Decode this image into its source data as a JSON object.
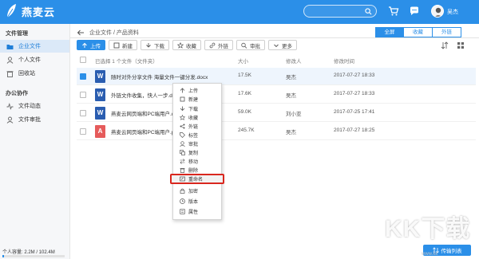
{
  "app": {
    "title": "燕麦云",
    "username": "吴杰",
    "brand_color": "#2b8fe8"
  },
  "search": {
    "placeholder": ""
  },
  "top_icons": [
    "cart-icon",
    "chat-icon",
    "message-icon"
  ],
  "sidebar": {
    "groups": [
      {
        "label": "文件管理",
        "items": [
          {
            "label": "企业文件",
            "icon": "folder-icon",
            "active": true
          },
          {
            "label": "个人文件",
            "icon": "person-icon",
            "active": false
          },
          {
            "label": "回收站",
            "icon": "trash-icon",
            "active": false
          }
        ]
      },
      {
        "label": "办公协作",
        "items": [
          {
            "label": "文件动态",
            "icon": "activity-icon",
            "active": false
          },
          {
            "label": "文件审批",
            "icon": "approve-icon",
            "active": false
          }
        ]
      }
    ],
    "storage_text": "个人容量: 2.2M / 102.4M",
    "storage_fraction": 0.02
  },
  "breadcrumb": {
    "text": "企业文件 / 产品资料"
  },
  "view_tabs": [
    {
      "label": "全屏",
      "active": true
    },
    {
      "label": "收藏",
      "active": false
    },
    {
      "label": "外链",
      "active": false
    }
  ],
  "toolbar": [
    {
      "label": "上传",
      "icon": "upload-icon",
      "primary": true
    },
    {
      "label": "新建",
      "icon": "new-icon",
      "primary": false
    },
    {
      "label": "下载",
      "icon": "download-icon",
      "primary": false
    },
    {
      "label": "收藏",
      "icon": "star-icon",
      "primary": false
    },
    {
      "label": "外链",
      "icon": "link-icon",
      "primary": false
    },
    {
      "label": "审批",
      "icon": "approve-icon",
      "primary": false
    },
    {
      "label": "更多",
      "icon": "more-icon",
      "primary": false
    }
  ],
  "table": {
    "headers": {
      "name": "已选择 1 个文件（文件夹）",
      "size": "大小",
      "owner": "修改人",
      "date": "修改时间"
    },
    "rows": [
      {
        "type": "word",
        "name": "随时对外分享文件 海量文件一键分发.docx",
        "size": "17.5K",
        "owner": "吴杰",
        "date": "2017-07-27 18:33",
        "selected": true,
        "icon_color": "#2a5db0"
      },
      {
        "type": "word",
        "name": "外链文件收集，快人一步.docx",
        "size": "17.6K",
        "owner": "吴杰",
        "date": "2017-07-27 18:33",
        "selected": false,
        "icon_color": "#2a5db0"
      },
      {
        "type": "word",
        "name": "燕麦云网页端和PC端用户.docx",
        "size": "59.0K",
        "owner": "刘小亚",
        "date": "2017-07-25 17:41",
        "selected": false,
        "icon_color": "#2a5db0"
      },
      {
        "type": "pdf",
        "name": "燕麦云网页端和PC端用户.pdf",
        "size": "245.7K",
        "owner": "吴杰",
        "date": "2017-07-27 18:25",
        "selected": false,
        "icon_color": "#e55b5b"
      }
    ]
  },
  "context_menu": {
    "items": [
      {
        "label": "上传",
        "icon": "upload-icon"
      },
      {
        "label": "新建",
        "icon": "new-icon"
      },
      {
        "label": "下载",
        "icon": "download-icon"
      },
      {
        "label": "收藏",
        "icon": "star-icon"
      },
      {
        "label": "外链",
        "icon": "share-icon"
      },
      {
        "label": "标签",
        "icon": "tag-icon"
      },
      {
        "label": "审批",
        "icon": "approve-icon"
      },
      {
        "label": "复制",
        "icon": "copy-icon"
      },
      {
        "label": "移动",
        "icon": "move-icon"
      },
      {
        "label": "删除",
        "icon": "delete-icon"
      },
      {
        "label": "重命名",
        "icon": "rename-icon",
        "highlighted": true
      },
      {
        "label": "加密",
        "icon": "lock-icon"
      },
      {
        "label": "版本",
        "icon": "version-icon"
      },
      {
        "label": "属性",
        "icon": "info-icon"
      }
    ]
  },
  "transfer_button": {
    "label": "传输列表"
  },
  "watermark": {
    "text": "KK下载",
    "subtext": "www.kk"
  }
}
